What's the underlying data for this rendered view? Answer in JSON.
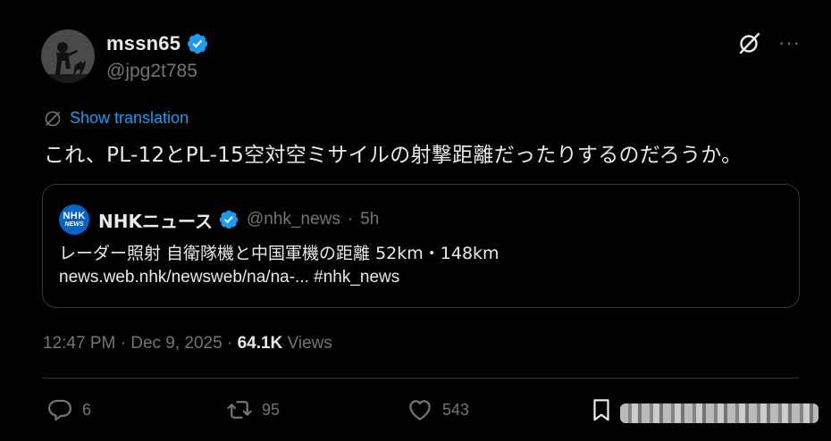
{
  "author": {
    "display_name": "mssn65",
    "handle": "@jpg2t785",
    "verified": true
  },
  "icons": {
    "grok": "grok-icon",
    "more": "more-icon",
    "translate": "globe-icon",
    "verified": "verified-badge-icon"
  },
  "more_label": "···",
  "translate_label": "Show translation",
  "tweet_text": "これ、PL-12とPL-15空対空ミサイルの射撃距離だったりするのだろうか。",
  "quote": {
    "avatar_line1": "NHK",
    "avatar_line2": "NEWS",
    "name": "NHKニュース",
    "handle": "@nhk_news",
    "separator": "·",
    "time": "5h",
    "line1": "レーダー照射 自衛隊機と中国軍機の距離 52km・148km",
    "line2": "news.web.nhk/newsweb/na/na-... #nhk_news"
  },
  "meta": {
    "time": "12:47 PM",
    "date": "Dec 9, 2025",
    "separator": "·",
    "views_count": "64.1K",
    "views_label": "Views"
  },
  "actions": {
    "replies": "6",
    "retweets": "95",
    "likes": "543"
  },
  "colors": {
    "background": "#000000",
    "text": "#e7e9ea",
    "muted": "#71767b",
    "accent": "#1d9bf0",
    "nhk_blue": "#0064c8"
  }
}
